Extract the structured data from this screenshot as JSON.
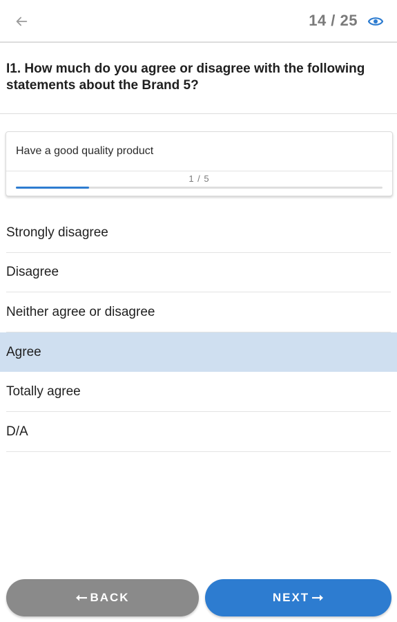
{
  "header": {
    "progress_text": "14 / 25",
    "icons": {
      "back": "arrow-left-icon",
      "preview": "eye-icon"
    },
    "accent_color": "#2d7cd0"
  },
  "question": {
    "text": "I1. How much do you agree or disagree with the following statements about the Brand 5?"
  },
  "statement_card": {
    "text": "Have a good quality product",
    "step_text": "1 / 5",
    "progress_fraction": 0.2
  },
  "options": [
    {
      "label": "Strongly disagree",
      "selected": false
    },
    {
      "label": "Disagree",
      "selected": false
    },
    {
      "label": "Neither agree or disagree",
      "selected": false
    },
    {
      "label": "Agree",
      "selected": true
    },
    {
      "label": "Totally agree",
      "selected": false
    },
    {
      "label": "D/A",
      "selected": false
    }
  ],
  "footer": {
    "back_label": "BACK",
    "next_label": "NEXT",
    "back_color": "#8a8a8a",
    "next_color": "#2d7cd0",
    "selected_bg": "#cfdff0"
  }
}
